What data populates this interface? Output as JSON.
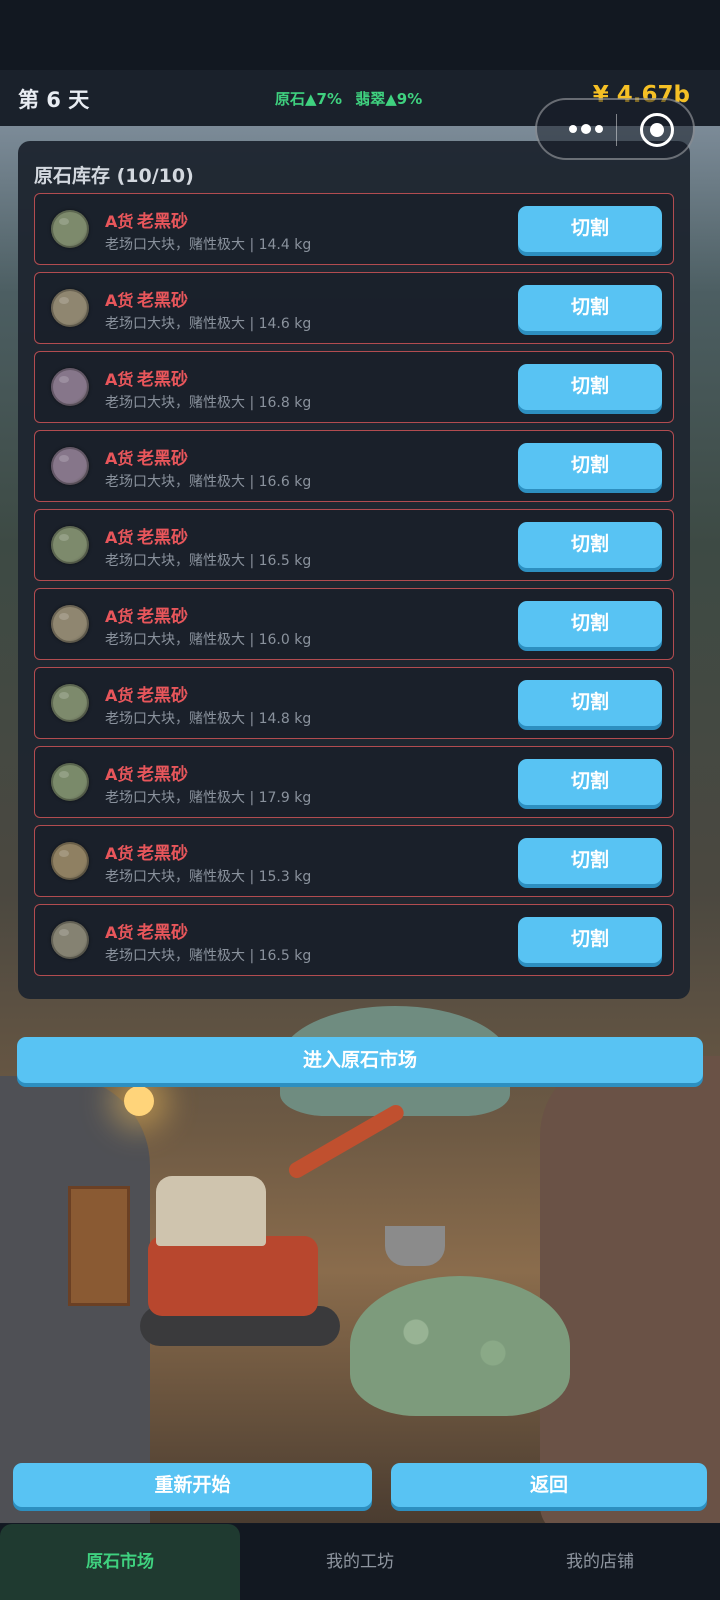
{
  "header": {
    "day_label": "第 6 天",
    "price_changes": [
      {
        "label": "原石▲7%"
      },
      {
        "label": "翡翠▲9%"
      }
    ],
    "money": "¥ 4.67b"
  },
  "capsule": {
    "more_icon": "more-dots-icon",
    "close_icon": "target-circle-icon"
  },
  "inventory": {
    "title": "原石库存 (10/10)",
    "cut_label": "切割",
    "items": [
      {
        "grade": "A货",
        "name": "老黑砂",
        "desc": "老场口大块，赌性极大 | 14.4 kg",
        "color": "#7d8a6c"
      },
      {
        "grade": "A货",
        "name": "老黑砂",
        "desc": "老场口大块，赌性极大 | 14.6 kg",
        "color": "#8f8670"
      },
      {
        "grade": "A货",
        "name": "老黑砂",
        "desc": "老场口大块，赌性极大 | 16.8 kg",
        "color": "#86768a"
      },
      {
        "grade": "A货",
        "name": "老黑砂",
        "desc": "老场口大块，赌性极大 | 16.6 kg",
        "color": "#86768a"
      },
      {
        "grade": "A货",
        "name": "老黑砂",
        "desc": "老场口大块，赌性极大 | 16.5 kg",
        "color": "#7d8a6c"
      },
      {
        "grade": "A货",
        "name": "老黑砂",
        "desc": "老场口大块，赌性极大 | 16.0 kg",
        "color": "#8f8670"
      },
      {
        "grade": "A货",
        "name": "老黑砂",
        "desc": "老场口大块，赌性极大 | 14.8 kg",
        "color": "#7d8a6c"
      },
      {
        "grade": "A货",
        "name": "老黑砂",
        "desc": "老场口大块，赌性极大 | 17.9 kg",
        "color": "#7a8a6a"
      },
      {
        "grade": "A货",
        "name": "老黑砂",
        "desc": "老场口大块，赌性极大 | 15.3 kg",
        "color": "#8f8062"
      },
      {
        "grade": "A货",
        "name": "老黑砂",
        "desc": "老场口大块，赌性极大 | 16.5 kg",
        "color": "#858272"
      }
    ]
  },
  "actions": {
    "enter_market": "进入原石市场",
    "restart": "重新开始",
    "back": "返回"
  },
  "nav": {
    "tabs": [
      {
        "label": "原石市场",
        "active": true
      },
      {
        "label": "我的工坊",
        "active": false
      },
      {
        "label": "我的店铺",
        "active": false
      }
    ]
  }
}
